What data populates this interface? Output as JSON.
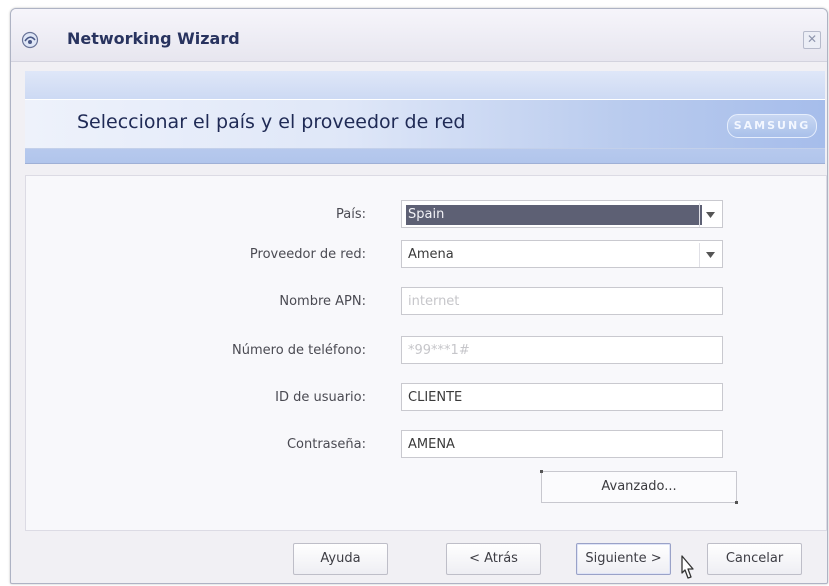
{
  "window": {
    "title": "Networking Wizard",
    "icons": {
      "app": "network-wizard-icon",
      "close": "close-icon"
    }
  },
  "banner": {
    "heading": "Seleccionar el país y el proveedor de red",
    "brand": "SAMSUNG"
  },
  "form": {
    "country": {
      "label": "País:",
      "value": "Spain"
    },
    "provider": {
      "label": "Proveedor de red:",
      "value": "Amena"
    },
    "apn": {
      "label": "Nombre APN:",
      "value": "internet"
    },
    "phone": {
      "label": "Número de teléfono:",
      "value": "*99***1#"
    },
    "user_id": {
      "label": "ID de usuario:",
      "value": "CLIENTE"
    },
    "password": {
      "label": "Contraseña:",
      "value": "AMENA"
    },
    "advanced_button": "Avanzado..."
  },
  "buttons": {
    "help": "Ayuda",
    "back": "< Atrás",
    "next": "Siguiente >",
    "cancel": "Cancelar"
  },
  "colors": {
    "title_text": "#28335f",
    "selection": "#5d6074",
    "banner": "#b1c5ec"
  }
}
